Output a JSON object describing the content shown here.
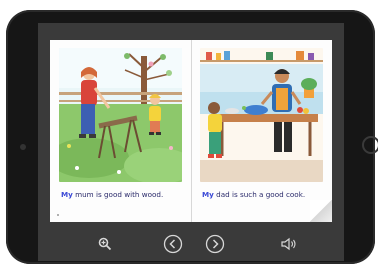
{
  "book": {
    "left_page": {
      "caption_first": "My",
      "caption_rest": " mum is good with wood."
    },
    "right_page": {
      "caption_first": "My",
      "caption_rest": " dad is such a good cook."
    }
  },
  "toolbar": {
    "zoom": "zoom-in-icon",
    "prev": "chevron-left-icon",
    "next": "chevron-right-icon",
    "audio": "speaker-icon"
  },
  "colors": {
    "bezel": "#161616",
    "screen_bg": "#3a3a3a",
    "caption_text": "#2b2b6b",
    "caption_highlight": "#3d4bd6"
  }
}
